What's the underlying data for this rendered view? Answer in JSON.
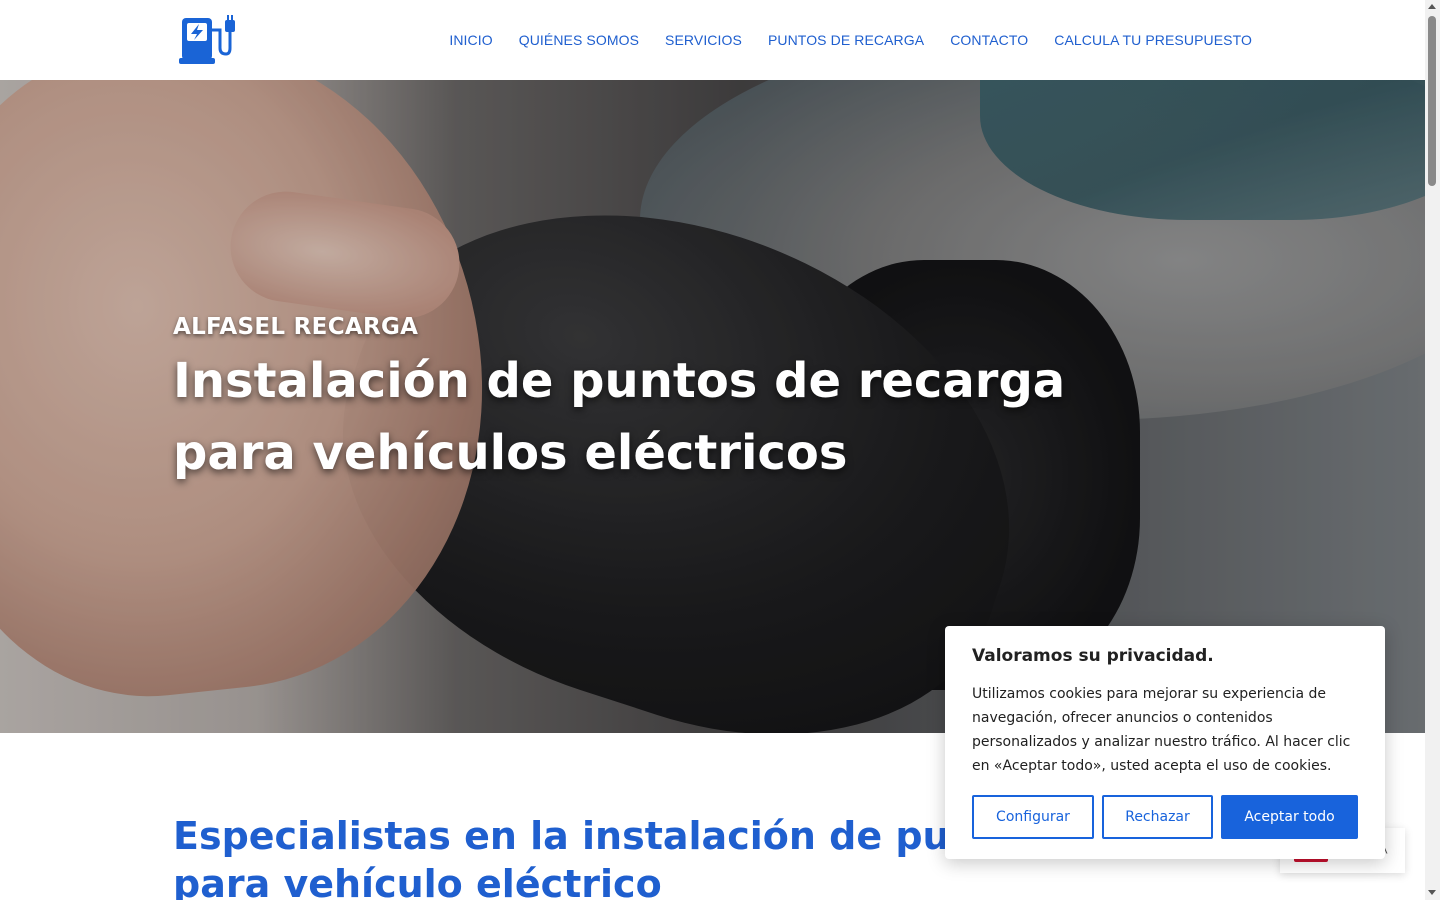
{
  "header": {
    "logo_icon": "ev-charging-station-icon",
    "nav": [
      {
        "label": "INICIO"
      },
      {
        "label": "QUIÉNES SOMOS"
      },
      {
        "label": "SERVICIOS"
      },
      {
        "label": "PUNTOS DE RECARGA"
      },
      {
        "label": "CONTACTO"
      },
      {
        "label": "CALCULA TU PRESUPUESTO"
      }
    ]
  },
  "hero": {
    "subtitle": "ALFASEL RECARGA",
    "title": "Instalación de puntos de recarga para vehículos eléctricos"
  },
  "section": {
    "title": "Especialistas en la instalación de puntos de recarga para vehículo eléctrico"
  },
  "cookie": {
    "title": "Valoramos su privacidad.",
    "text": "Utilizamos cookies para mejorar su experiencia de navegación, ofrecer anuncios o contenidos personalizados y analizar nuestro tráfico. Al hacer clic en «Aceptar todo», usted acepta el uso de cookies.",
    "buttons": {
      "configure": "Configurar",
      "reject": "Rechazar",
      "accept": "Aceptar todo"
    }
  },
  "colors": {
    "brand_blue": "#1f5fcf",
    "cookie_blue": "#1863dc"
  }
}
